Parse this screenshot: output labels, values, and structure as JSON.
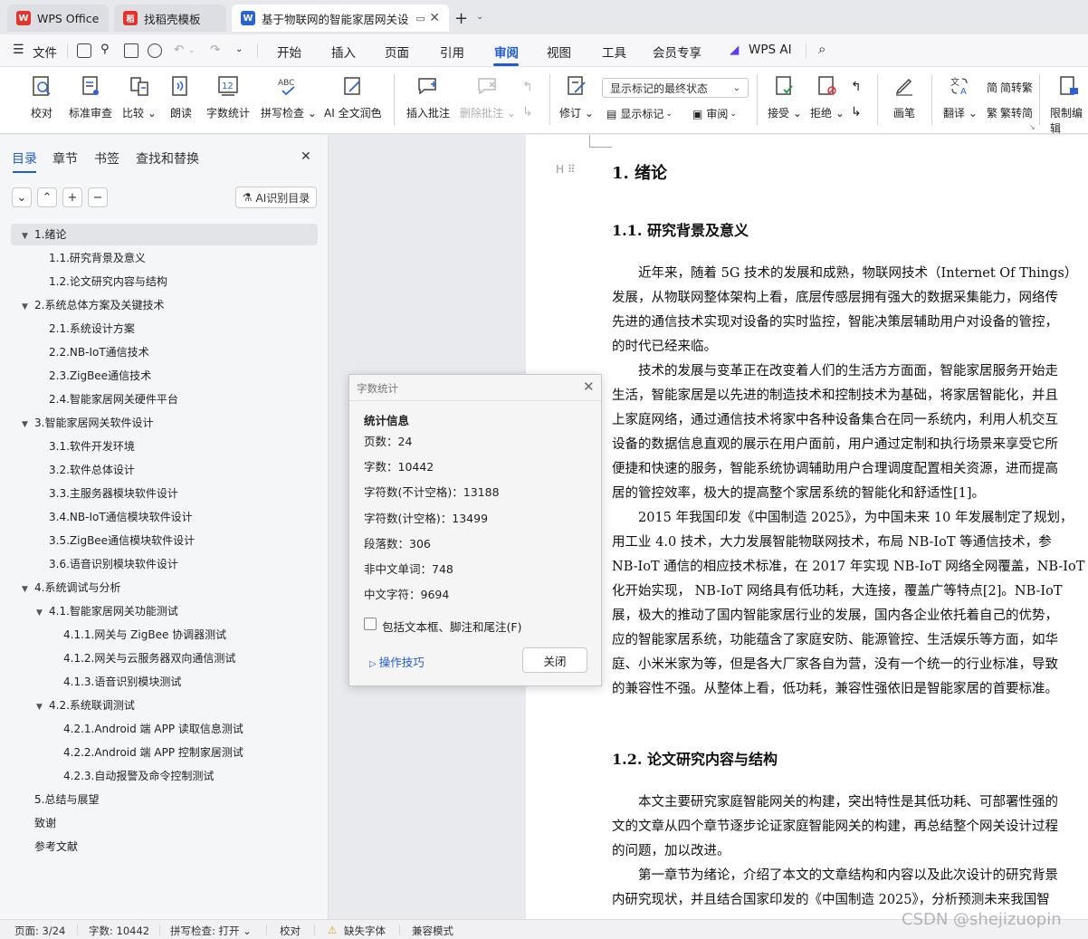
{
  "tabs": [
    {
      "label": "WPS Office",
      "logo": "W"
    },
    {
      "label": "找稻壳模板",
      "logo": "稻"
    },
    {
      "label": "基于物联网的智能家居网关设",
      "logo": "W"
    }
  ],
  "menubar": {
    "file": "文件",
    "items": [
      "开始",
      "插入",
      "页面",
      "引用",
      "审阅",
      "视图",
      "工具",
      "会员专享"
    ],
    "active": "审阅",
    "wpsai": "WPS AI"
  },
  "ribbon": {
    "buttons": [
      "校对",
      "标准审查",
      "比较",
      "朗读",
      "字数统计",
      "拼写检查",
      "AI 全文润色",
      "插入批注",
      "删除批注",
      "修订",
      "画笔",
      "翻译",
      "限制编辑"
    ],
    "show_markup_state": "显示标记的最终状态",
    "show_markup": "显示标记",
    "review": "审阅",
    "accept": "接受",
    "reject": "拒绝",
    "to_traditional": "简转繁",
    "to_simplified": "繁转简"
  },
  "leftpane": {
    "tabs": [
      "目录",
      "章节",
      "书签",
      "查找和替换"
    ],
    "ai_toc": "AI识别目录",
    "toc": [
      {
        "level": 1,
        "text": "1.绪论",
        "expand": true
      },
      {
        "level": 2,
        "text": "1.1.研究背景及意义"
      },
      {
        "level": 2,
        "text": "1.2.论文研究内容与结构"
      },
      {
        "level": 1,
        "text": "2.系统总体方案及关键技术",
        "expand": true
      },
      {
        "level": 2,
        "text": "2.1.系统设计方案"
      },
      {
        "level": 2,
        "text": "2.2.NB-IoT通信技术"
      },
      {
        "level": 2,
        "text": "2.3.ZigBee通信技术"
      },
      {
        "level": 2,
        "text": "2.4.智能家居网关硬件平台"
      },
      {
        "level": 1,
        "text": "3.智能家居网关软件设计",
        "expand": true
      },
      {
        "level": 2,
        "text": "3.1.软件开发环境"
      },
      {
        "level": 2,
        "text": "3.2.软件总体设计"
      },
      {
        "level": 2,
        "text": "3.3.主服务器模块软件设计"
      },
      {
        "level": 2,
        "text": "3.4.NB-IoT通信模块软件设计"
      },
      {
        "level": 2,
        "text": "3.5.ZigBee通信模块软件设计"
      },
      {
        "level": 2,
        "text": "3.6.语音识别模块软件设计"
      },
      {
        "level": 1,
        "text": "4.系统调试与分析",
        "expand": true
      },
      {
        "level": 2,
        "text": "4.1.智能家居网关功能测试",
        "expand": true
      },
      {
        "level": 3,
        "text": "4.1.1.网关与 ZigBee 协调器测试"
      },
      {
        "level": 3,
        "text": "4.1.2.网关与云服务器双向通信测试"
      },
      {
        "level": 3,
        "text": "4.1.3.语音识别模块测试"
      },
      {
        "level": 2,
        "text": "4.2.系统联调测试",
        "expand": true
      },
      {
        "level": 3,
        "text": "4.2.1.Android 端 APP 读取信息测试"
      },
      {
        "level": 3,
        "text": "4.2.2.Android 端 APP 控制家居测试"
      },
      {
        "level": 3,
        "text": "4.2.3.自动报警及命令控制测试"
      },
      {
        "level": 1,
        "text": "5.总结与展望"
      },
      {
        "level": 1,
        "text": "致谢"
      },
      {
        "level": 1,
        "text": "参考文献"
      }
    ]
  },
  "document": {
    "h1": "1.  绪论",
    "h2a": "1.1.  研究背景及意义",
    "h2b": "1.2.  论文研究内容与结构",
    "p1": [
      "　　近年来，随着 5G 技术的发展和成熟，物联网技术（Internet Of Things）",
      "发展，从物联网整体架构上看，底层传感层拥有强大的数据采集能力，网络传",
      "先进的通信技术实现对设备的实时监控，智能决策层辅助用户对设备的管控，",
      "的时代已经来临。"
    ],
    "p2": [
      "　　技术的发展与变革正在改变着人们的生活方方面面，智能家居服务开始走",
      "生活，智能家居是以先进的制造技术和控制技术为基础，将家居智能化，并且",
      "上家庭网络，通过通信技术将家中各种设备集合在同一系统内，利用人机交互",
      "设备的数据信息直观的展示在用户面前，用户通过定制和执行场景来享受它所",
      "便捷和快速的服务，智能系统协调辅助用户合理调度配置相关资源，进而提高",
      "居的管控效率，极大的提高整个家居系统的智能化和舒适性[1]。"
    ],
    "p3": [
      "　　2015 年我国印发《中国制造 2025》，为中国未来 10 年发展制定了规划，",
      "用工业 4.0 技术，大力发展智能物联网技术，布局 NB-IoT 等通信技术，参",
      "NB-IoT 通信的相应技术标准，在 2017 年实现 NB-IoT 网络全网覆盖，NB-IoT",
      "化开始实现，  NB-IoT 网络具有低功耗，大连接，覆盖广等特点[2]。NB-IoT",
      "展，极大的推动了国内智能家居行业的发展，国内各企业依托着自己的优势，",
      "应的智能家居系统，功能蕴含了家庭安防、能源管控、生活娱乐等方面，如华",
      "庭、小米米家为等，但是各大厂家各自为营，没有一个统一的行业标准，导致",
      "的兼容性不强。从整体上看，低功耗，兼容性强依旧是智能家居的首要标准。"
    ],
    "p4": [
      "　　本文主要研究家庭智能网关的构建，突出特性是其低功耗、可部署性强的",
      "文的文章从四个章节逐步论证家庭智能网关的构建，再总结整个网关设计过程",
      "的问题，加以改进。",
      "　　第一章节为绪论，介绍了本文的文章结构和内容以及此次设计的研究背景",
      "内研究现状，并且结合国家印发的《中国制造 2025》，分析预测未来我国智"
    ]
  },
  "dialog": {
    "title": "字数统计",
    "heading": "统计信息",
    "rows": [
      "页数：24",
      "字数：10442",
      "字符数(不计空格)：13188",
      "字符数(计空格)：13499",
      "段落数：306",
      "非中文单词：748",
      "中文字符：9694"
    ],
    "checkbox": "包括文本框、脚注和尾注(F)",
    "tips": "操作技巧",
    "close": "关闭"
  },
  "status": {
    "page": "页面: 3/24",
    "words": "字数: 10442",
    "spell": "拼写检查: 打开",
    "proof": "校对",
    "missing_font": "缺失字体",
    "compat": "兼容模式"
  },
  "watermark": "CSDN @shejizuopin"
}
